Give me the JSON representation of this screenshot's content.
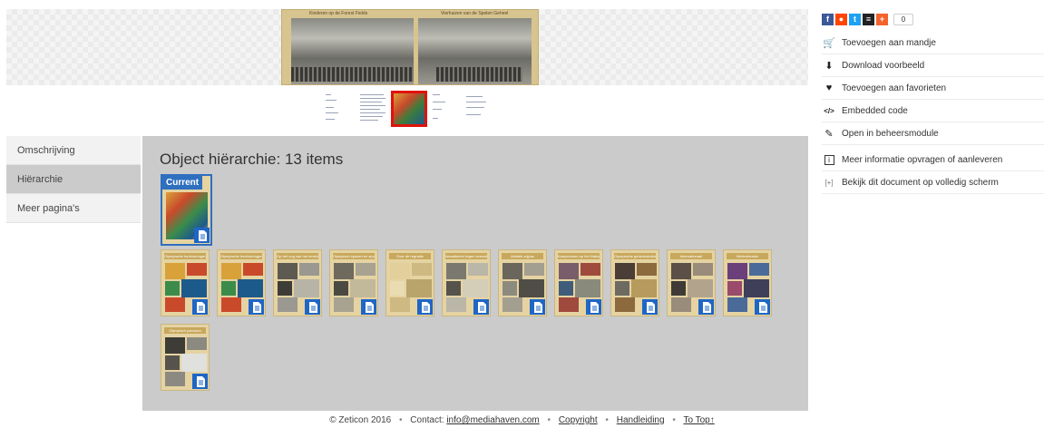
{
  "viewer": {
    "caption_left": "Kinderen op de Forest Fields",
    "caption_right": "Vierhuizen van de Spelen Geheel"
  },
  "tabs": [
    {
      "label": "Omschrijving",
      "active": false
    },
    {
      "label": "Hiërarchie",
      "active": true
    },
    {
      "label": "Meer pagina's",
      "active": false
    }
  ],
  "hierarchy": {
    "title": "Object hiërarchie: 13 items",
    "current_label": "Current",
    "items": [
      {
        "title": "Olympische herinneringen"
      },
      {
        "title": "Olympische herinneringen"
      },
      {
        "title": "Op het oog van het terrein"
      },
      {
        "title": "Olympisch spoken en sport"
      },
      {
        "title": "Over de regnatie"
      },
      {
        "title": "Ideaalbeeld lingen evenals"
      },
      {
        "title": "Atletiek vrijpas"
      },
      {
        "title": "Kampioenen op het Nationaal"
      },
      {
        "title": "Olympische gedenkstukken"
      },
      {
        "title": "Internationaal"
      },
      {
        "title": "Wielerfeesten"
      },
      {
        "title": "Olympisch parcours"
      }
    ]
  },
  "share": {
    "buttons": [
      {
        "icon": "facebook-icon",
        "glyph": "f",
        "color": "#3b5998"
      },
      {
        "icon": "reddit-icon",
        "glyph": "●",
        "color": "#ff4500"
      },
      {
        "icon": "twitter-icon",
        "glyph": "t",
        "color": "#1da1f2"
      },
      {
        "icon": "buffer-icon",
        "glyph": "≡",
        "color": "#222222"
      },
      {
        "icon": "plus-icon",
        "glyph": "+",
        "color": "#f4632c"
      }
    ],
    "count": "0"
  },
  "actions": [
    {
      "icon": "cart-icon",
      "glyph": "🛒",
      "label": "Toevoegen aan mandje"
    },
    {
      "icon": "download-icon",
      "glyph": "⬇",
      "label": "Download voorbeeld"
    },
    {
      "icon": "heart-icon",
      "glyph": "♥",
      "label": "Toevoegen aan favorieten"
    },
    {
      "icon": "code-icon",
      "glyph": "</>",
      "label": "Embedded code"
    },
    {
      "icon": "pencil-icon",
      "glyph": "✎",
      "label": "Open in beheersmodule"
    },
    {
      "icon": "info-icon",
      "glyph": "i",
      "label": "Meer informatie opvragen of aanleveren"
    },
    {
      "icon": "fullscreen-icon",
      "glyph": "[+]",
      "label": "Bekijk dit document op volledig scherm"
    }
  ],
  "footer": {
    "copyright": "© Zeticon 2016",
    "contact_prefix": "Contact: ",
    "contact_email": "info@mediahaven.com",
    "copyright_link": "Copyright",
    "manual_link": "Handleiding",
    "top_link": "To Top↑"
  }
}
